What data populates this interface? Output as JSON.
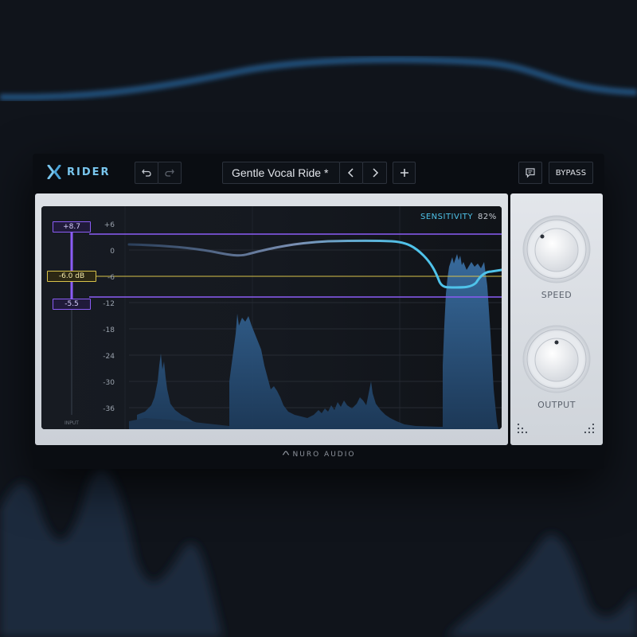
{
  "app": {
    "logo_text": "RIDER",
    "brand": "NURO AUDIO"
  },
  "toolbar": {
    "undo_icon": "undo-icon",
    "redo_icon": "redo-icon",
    "preset_name": "Gentle Vocal Ride *",
    "prev_icon": "chevron-left-icon",
    "next_icon": "chevron-right-icon",
    "add_icon": "plus-icon",
    "feedback_icon": "chat-icon",
    "bypass_label": "BYPASS"
  },
  "display": {
    "sensitivity_label": "SENSITIVITY",
    "sensitivity_value": "82%",
    "input_label": "INPUT",
    "range_top": "+8.7",
    "target_level": "-6.0 dB",
    "range_bottom": "-5.5",
    "scale": [
      "+6",
      "0",
      "-6",
      "-12",
      "-18",
      "-24",
      "-30",
      "-36"
    ]
  },
  "controls": {
    "speed_label": "SPEED",
    "output_label": "OUTPUT"
  },
  "colors": {
    "accent_cyan": "#4fc3ea",
    "range_purple": "#8b5cf6",
    "target_yellow": "#d8c24a",
    "waveform_blue": "#2f5f8f"
  }
}
